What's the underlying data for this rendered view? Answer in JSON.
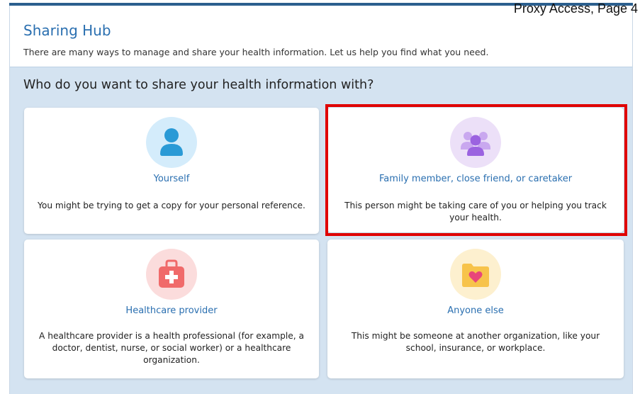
{
  "page_tag": "Proxy Access, Page 4",
  "header": {
    "title": "Sharing Hub",
    "subtitle": "There are many ways to manage and share your health information. Let us help you find what you need."
  },
  "question": "Who do you want to share your health information with?",
  "options": [
    {
      "title": "Yourself",
      "description": "You might be trying to get a copy for your personal reference.",
      "icon": "person-icon",
      "icon_bg": "#d4ecfb",
      "icon_color": "#2a9ad6"
    },
    {
      "title": "Family member, close friend, or caretaker",
      "description": "This person might be taking care of you or helping you track your health.",
      "icon": "group-icon",
      "icon_bg": "#ece0f8",
      "icon_color": "#9b63e0"
    },
    {
      "title": "Healthcare provider",
      "description": "A healthcare provider is a health professional (for example, a doctor, dentist, nurse, or social worker) or a healthcare organization.",
      "icon": "medical-bag-icon",
      "icon_bg": "#fbdcdc",
      "icon_color": "#f06a6a"
    },
    {
      "title": "Anyone else",
      "description": "This might be someone at another organization, like your school, insurance, or workplace.",
      "icon": "heart-folder-icon",
      "icon_bg": "#fdf0cf",
      "icon_color": "#f7c34b"
    }
  ],
  "colors": {
    "accent": "#2a6fb0",
    "highlight": "#e00000",
    "panel_bg": "#d4e3f1"
  }
}
